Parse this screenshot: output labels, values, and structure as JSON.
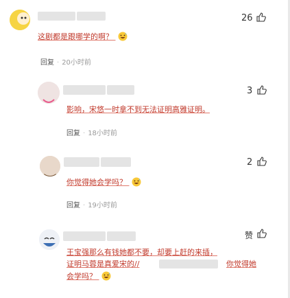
{
  "comments": [
    {
      "likes": "26",
      "text": "这剧都是跟哪学的啊？",
      "reply_label": "回复",
      "time": "20小时前",
      "emoji": "smile-sweat"
    },
    {
      "likes": "3",
      "text": "影响，宋悠一时拿不到无法证明高雅证明。",
      "reply_label": "回复",
      "time": "18小时前"
    },
    {
      "likes": "2",
      "text": "你觉得她会学吗？",
      "reply_label": "回复",
      "time": "19小时前",
      "emoji": "smile-sweat"
    },
    {
      "likes": "赞",
      "text_line1": "王宝强那么有钱她都不要，却要上赶的来插，",
      "text_line2": "证明马蓉是真爱宋的//",
      "text_line2b": "你觉得她",
      "text_line3": "会学吗？",
      "emoji": "smile-sweat"
    }
  ],
  "colors": {
    "accent": "#f5c518",
    "muted": "#9a9a9a"
  }
}
